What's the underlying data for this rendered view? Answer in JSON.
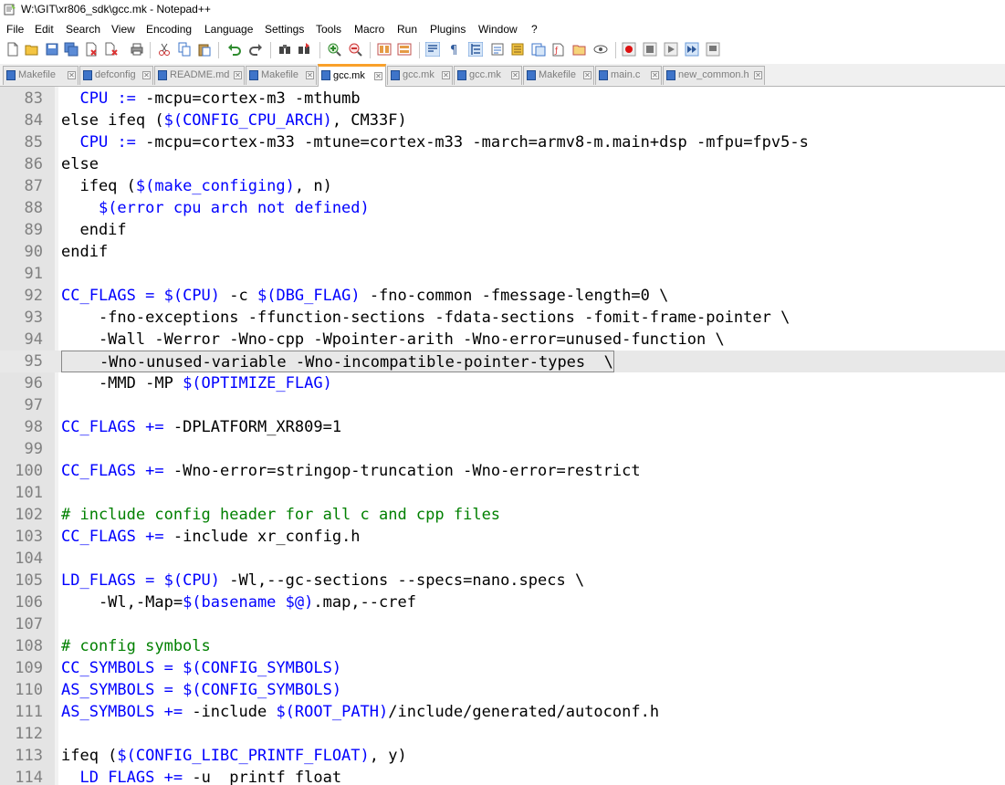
{
  "window": {
    "title": "W:\\GIT\\xr806_sdk\\gcc.mk - Notepad++"
  },
  "menu": [
    "File",
    "Edit",
    "Search",
    "View",
    "Encoding",
    "Language",
    "Settings",
    "Tools",
    "Macro",
    "Run",
    "Plugins",
    "Window",
    "?"
  ],
  "toolbar": {
    "buttons": [
      "new-file-icon",
      "open-file-icon",
      "save-icon",
      "save-all-icon",
      "close-icon",
      "close-all-icon",
      "print-icon",
      "cut-icon",
      "copy-icon",
      "paste-icon",
      "undo-icon",
      "redo-icon",
      "find-icon",
      "replace-icon",
      "zoom-in-icon",
      "zoom-out-icon",
      "sync-vertical-icon",
      "sync-horizontal-icon",
      "word-wrap-icon",
      "show-all-chars-icon",
      "indent-guide-icon",
      "language-icon",
      "doc-map-icon",
      "function-list-icon",
      "folder-workspace-icon",
      "monitor-icon",
      "record-macro-icon",
      "stop-record-icon",
      "play-macro-icon",
      "run-macro-multiple-icon",
      "save-macro-icon"
    ]
  },
  "tabs": [
    {
      "label": "Makefile",
      "active": false
    },
    {
      "label": "defconfig",
      "active": false
    },
    {
      "label": "README.md",
      "active": false
    },
    {
      "label": "Makefile",
      "active": false
    },
    {
      "label": "gcc.mk",
      "active": true
    },
    {
      "label": "gcc.mk",
      "active": false
    },
    {
      "label": "gcc.mk",
      "active": false
    },
    {
      "label": "Makefile",
      "active": false
    },
    {
      "label": "main.c",
      "active": false
    },
    {
      "label": "new_common.h",
      "active": false
    }
  ],
  "editor": {
    "current_line": "95",
    "lines": [
      {
        "n": "83",
        "segs": [
          [
            "  ",
            "d"
          ],
          [
            "CPU",
            "v"
          ],
          [
            " := ",
            "v"
          ],
          [
            "-mcpu=cortex-m3 -mthumb",
            "d"
          ]
        ]
      },
      {
        "n": "84",
        "segs": [
          [
            "else ifeq (",
            "d"
          ],
          [
            "$(CONFIG_CPU_ARCH)",
            "v"
          ],
          [
            ", CM33F)",
            "d"
          ]
        ]
      },
      {
        "n": "85",
        "segs": [
          [
            "  ",
            "d"
          ],
          [
            "CPU",
            "v"
          ],
          [
            " := ",
            "v"
          ],
          [
            "-mcpu=cortex-m33 -mtune=cortex-m33 -march=armv8-m.main+dsp -mfpu=fpv5-s",
            "d"
          ]
        ]
      },
      {
        "n": "86",
        "segs": [
          [
            "else",
            "d"
          ]
        ]
      },
      {
        "n": "87",
        "segs": [
          [
            "  ifeq (",
            "d"
          ],
          [
            "$(make_configing)",
            "v"
          ],
          [
            ", n)",
            "d"
          ]
        ]
      },
      {
        "n": "88",
        "segs": [
          [
            "    ",
            "d"
          ],
          [
            "$(error cpu arch not defined)",
            "v"
          ]
        ]
      },
      {
        "n": "89",
        "segs": [
          [
            "  endif",
            "d"
          ]
        ]
      },
      {
        "n": "90",
        "segs": [
          [
            "endif",
            "d"
          ]
        ]
      },
      {
        "n": "91",
        "segs": []
      },
      {
        "n": "92",
        "segs": [
          [
            "CC_FLAGS",
            "v"
          ],
          [
            " = ",
            "v"
          ],
          [
            "$(CPU)",
            "v"
          ],
          [
            " -c ",
            "d"
          ],
          [
            "$(DBG_FLAG)",
            "v"
          ],
          [
            " -fno-common -fmessage-length=0 \\",
            "d"
          ]
        ]
      },
      {
        "n": "93",
        "segs": [
          [
            "    -fno-exceptions -ffunction-sections -fdata-sections -fomit-frame-pointer \\",
            "d"
          ]
        ]
      },
      {
        "n": "94",
        "segs": [
          [
            "    -Wall -Werror -Wno-cpp -Wpointer-arith -Wno-error=unused-function \\",
            "d"
          ]
        ]
      },
      {
        "n": "95",
        "segs": [
          [
            "    -Wno-unused-variable -Wno-incompatible-pointer-types  \\",
            "d"
          ]
        ]
      },
      {
        "n": "96",
        "segs": [
          [
            "    -MMD -MP ",
            "d"
          ],
          [
            "$(OPTIMIZE_FLAG)",
            "v"
          ]
        ]
      },
      {
        "n": "97",
        "segs": []
      },
      {
        "n": "98",
        "segs": [
          [
            "CC_FLAGS",
            "v"
          ],
          [
            " += ",
            "v"
          ],
          [
            "-DPLATFORM_XR809=1",
            "d"
          ]
        ]
      },
      {
        "n": "99",
        "segs": []
      },
      {
        "n": "100",
        "segs": [
          [
            "CC_FLAGS",
            "v"
          ],
          [
            " += ",
            "v"
          ],
          [
            "-Wno-error=stringop-truncation -Wno-error=restrict",
            "d"
          ]
        ]
      },
      {
        "n": "101",
        "segs": []
      },
      {
        "n": "102",
        "segs": [
          [
            "# include config header for all c and cpp files",
            "c"
          ]
        ]
      },
      {
        "n": "103",
        "segs": [
          [
            "CC_FLAGS",
            "v"
          ],
          [
            " += ",
            "v"
          ],
          [
            "-include xr_config.h",
            "d"
          ]
        ]
      },
      {
        "n": "104",
        "segs": []
      },
      {
        "n": "105",
        "segs": [
          [
            "LD_FLAGS",
            "v"
          ],
          [
            " = ",
            "v"
          ],
          [
            "$(CPU)",
            "v"
          ],
          [
            " -Wl,--gc-sections --specs=nano.specs \\",
            "d"
          ]
        ]
      },
      {
        "n": "106",
        "segs": [
          [
            "    -Wl,-Map=",
            "d"
          ],
          [
            "$(basename $@)",
            "v"
          ],
          [
            ".map,--cref",
            "d"
          ]
        ]
      },
      {
        "n": "107",
        "segs": []
      },
      {
        "n": "108",
        "segs": [
          [
            "# config symbols",
            "c"
          ]
        ]
      },
      {
        "n": "109",
        "segs": [
          [
            "CC_SYMBOLS",
            "v"
          ],
          [
            " = ",
            "v"
          ],
          [
            "$(CONFIG_SYMBOLS)",
            "v"
          ]
        ]
      },
      {
        "n": "110",
        "segs": [
          [
            "AS_SYMBOLS",
            "v"
          ],
          [
            " = ",
            "v"
          ],
          [
            "$(CONFIG_SYMBOLS)",
            "v"
          ]
        ]
      },
      {
        "n": "111",
        "segs": [
          [
            "AS_SYMBOLS",
            "v"
          ],
          [
            " += ",
            "v"
          ],
          [
            "-include ",
            "d"
          ],
          [
            "$(ROOT_PATH)",
            "v"
          ],
          [
            "/include/generated/autoconf.h",
            "d"
          ]
        ]
      },
      {
        "n": "112",
        "segs": []
      },
      {
        "n": "113",
        "segs": [
          [
            "ifeq (",
            "d"
          ],
          [
            "$(CONFIG_LIBC_PRINTF_FLOAT)",
            "v"
          ],
          [
            ", y)",
            "d"
          ]
        ]
      },
      {
        "n": "114",
        "segs": [
          [
            "  ",
            "d"
          ],
          [
            "LD_FLAGS",
            "v"
          ],
          [
            " += ",
            "v"
          ],
          [
            "-u _printf_float",
            "d"
          ]
        ]
      }
    ]
  },
  "colors": {
    "variable": "#0000ff",
    "default": "#000000",
    "comment": "#008000",
    "active_tab_accent": "#f9a02a"
  }
}
